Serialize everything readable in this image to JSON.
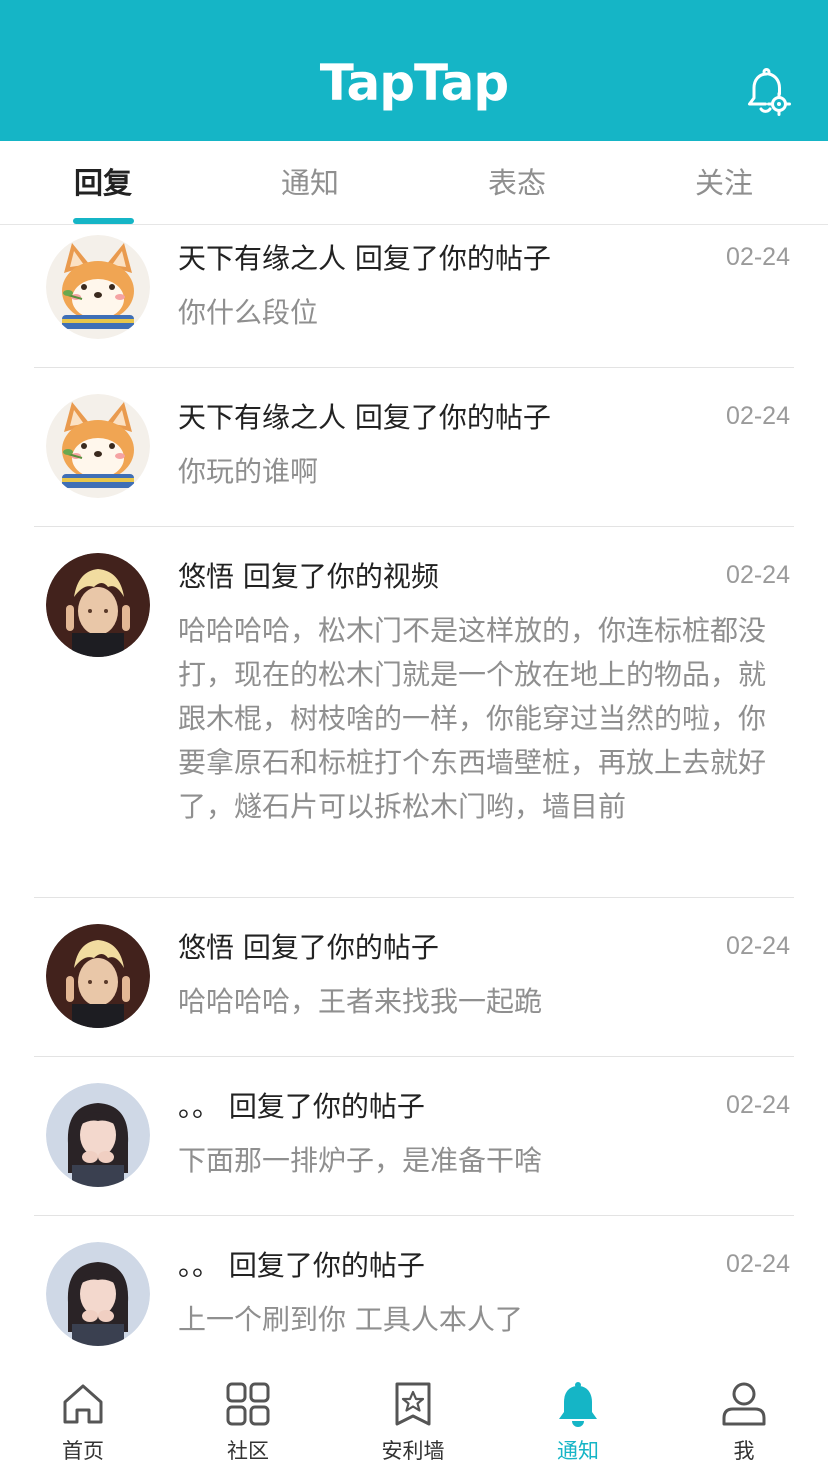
{
  "app": {
    "title": "TapTap"
  },
  "colors": {
    "accent": "#15b5c6",
    "title_text": "#222222",
    "secondary_text": "#8f8f8f"
  },
  "header": {
    "settings_icon": "bell-settings-icon"
  },
  "tabs": [
    {
      "label": "回复",
      "active": true
    },
    {
      "label": "通知",
      "active": false
    },
    {
      "label": "表态",
      "active": false
    },
    {
      "label": "关注",
      "active": false
    }
  ],
  "notifications": [
    {
      "title": "天下有缘之人 回复了你的帖子",
      "time": "02-24",
      "text": "你什么段位",
      "avatar": "shiba-dog-avatar"
    },
    {
      "title": "天下有缘之人 回复了你的帖子",
      "time": "02-24",
      "text": "你玩的谁啊",
      "avatar": "shiba-dog-avatar"
    },
    {
      "title": "悠悟 回复了你的视频",
      "time": "02-24",
      "text": "哈哈哈哈，松木门不是这样放的，你连标桩都没打，现在的松木门就是一个放在地上的物品，就跟木棍，树枝啥的一样，你能穿过当然的啦，你要拿原石和标桩打个东西墙壁桩，再放上去就好了，燧石片可以拆松木门哟，墙目前",
      "avatar": "blond-character-avatar"
    },
    {
      "title": "悠悟 回复了你的帖子",
      "time": "02-24",
      "text": "哈哈哈哈，王者来找我一起跪",
      "avatar": "blond-character-avatar"
    },
    {
      "title": "。。 回复了你的帖子",
      "time": "02-24",
      "text": "下面那一排炉子，是准备干啥",
      "avatar": "girl-photo-avatar"
    },
    {
      "title": "。。 回复了你的帖子",
      "time": "02-24",
      "text": "上一个刷到你 工具人本人了",
      "avatar": "girl-photo-avatar"
    }
  ],
  "bottom_nav": [
    {
      "label": "首页",
      "icon": "home-icon",
      "active": false
    },
    {
      "label": "社区",
      "icon": "grid-icon",
      "active": false
    },
    {
      "label": "安利墙",
      "icon": "bookmark-star-icon",
      "active": false
    },
    {
      "label": "通知",
      "icon": "bell-icon",
      "active": true
    },
    {
      "label": "我",
      "icon": "person-icon",
      "active": false
    }
  ]
}
